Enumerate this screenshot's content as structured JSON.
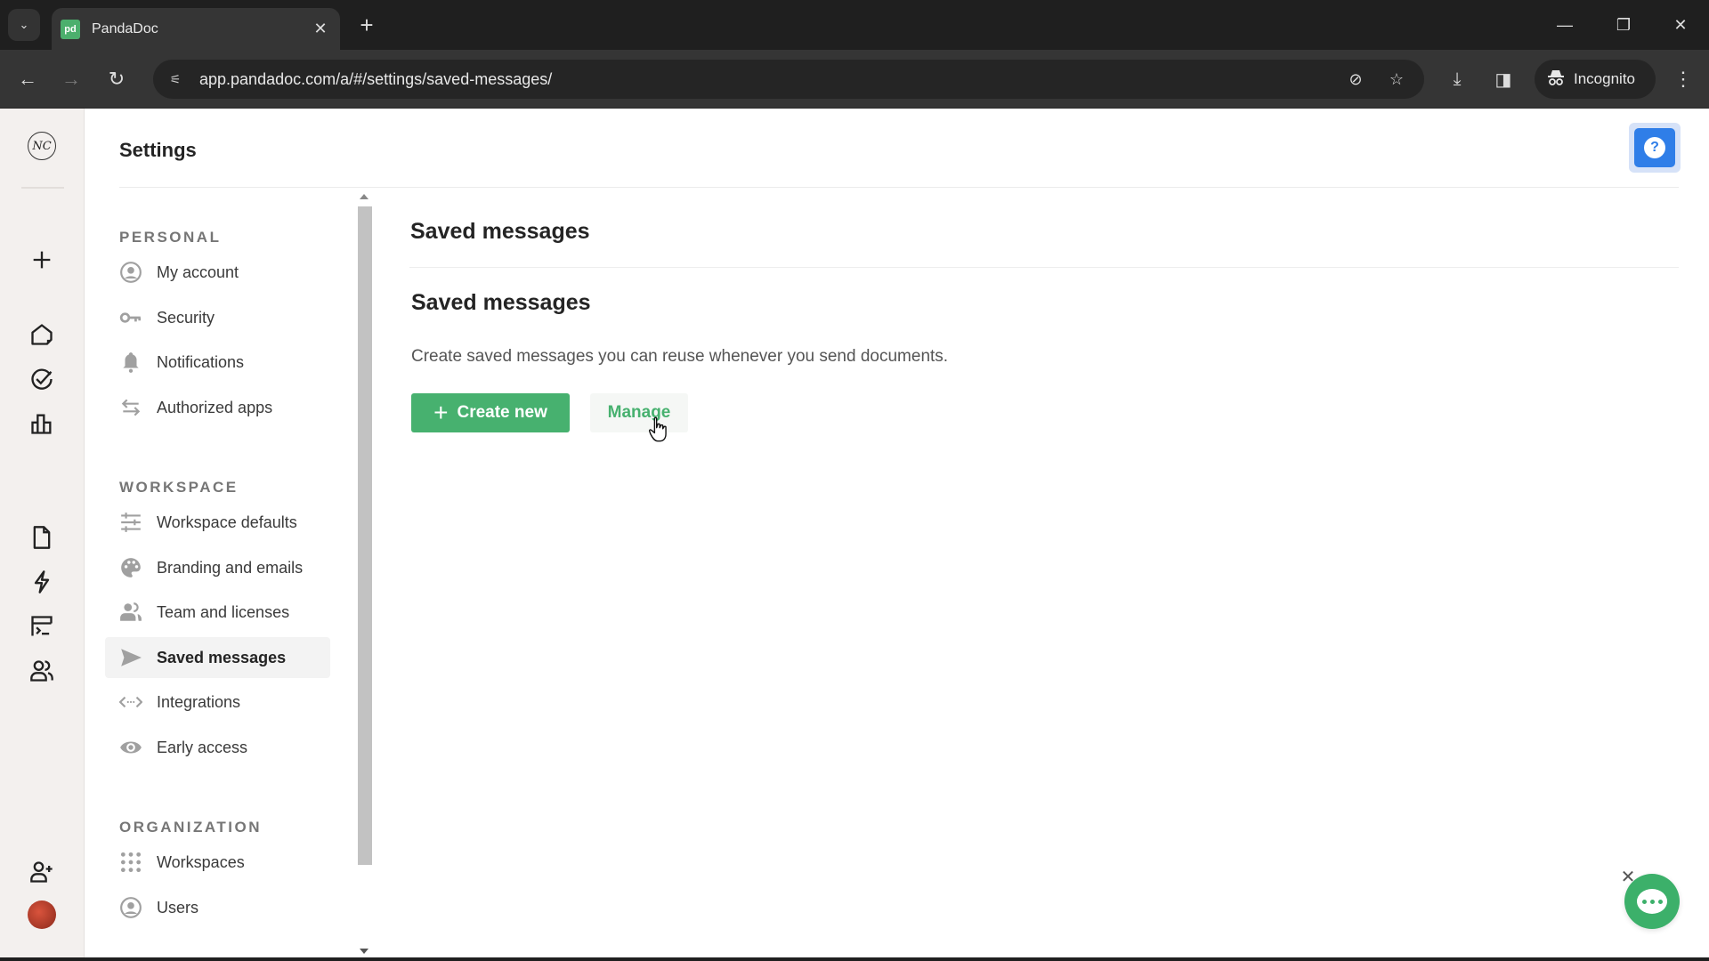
{
  "browser": {
    "tab_title": "PandaDoc",
    "tab_favicon": "pd",
    "url": "app.pandadoc.com/a/#/settings/saved-messages/",
    "incognito_label": "Incognito",
    "icons": {
      "tab_search": "chevron-down-icon",
      "tab_close": "close-icon",
      "new_tab": "plus-icon",
      "back": "arrow-left-icon",
      "forward": "arrow-right-icon",
      "reload": "reload-icon",
      "site_info": "tune-icon",
      "eye_off": "eye-off-icon",
      "bookmark": "star-icon",
      "download": "download-icon",
      "side_panel": "side-panel-icon",
      "incognito": "incognito-icon",
      "menu": "more-vertical-icon"
    },
    "glyphs": {
      "chevron": "⌄",
      "close": "✕",
      "plus": "+",
      "back": "←",
      "forward": "→",
      "reload": "↻",
      "tune": "⚟",
      "eye_off": "⊘",
      "star": "☆",
      "download": "⤓",
      "side_panel": "◨",
      "incognito": "🕶",
      "menu": "⋮",
      "minimize": "—",
      "restore": "❐",
      "win_close": "✕"
    }
  },
  "rail": {
    "logo_text": "NC",
    "items": [
      {
        "name": "create",
        "icon": "plus-icon"
      },
      {
        "name": "home",
        "icon": "home-icon"
      },
      {
        "name": "tasks",
        "icon": "check-circle-icon"
      },
      {
        "name": "reports",
        "icon": "bar-chart-icon"
      },
      {
        "name": "documents",
        "icon": "document-icon"
      },
      {
        "name": "automations",
        "icon": "lightning-icon"
      },
      {
        "name": "forms",
        "icon": "form-icon"
      },
      {
        "name": "contacts",
        "icon": "contacts-icon"
      },
      {
        "name": "invite",
        "icon": "add-user-icon"
      }
    ]
  },
  "settings": {
    "title": "Settings",
    "help_glyph": "?",
    "sections": [
      {
        "label": "PERSONAL",
        "items": [
          {
            "label": "My account",
            "icon": "user-circle-icon"
          },
          {
            "label": "Security",
            "icon": "key-icon"
          },
          {
            "label": "Notifications",
            "icon": "bell-icon"
          },
          {
            "label": "Authorized apps",
            "icon": "swap-arrows-icon"
          }
        ]
      },
      {
        "label": "WORKSPACE",
        "items": [
          {
            "label": "Workspace defaults",
            "icon": "sliders-icon"
          },
          {
            "label": "Branding and emails",
            "icon": "palette-icon"
          },
          {
            "label": "Team and licenses",
            "icon": "team-icon"
          },
          {
            "label": "Saved messages",
            "icon": "send-icon",
            "active": true
          },
          {
            "label": "Integrations",
            "icon": "code-icon"
          },
          {
            "label": "Early access",
            "icon": "eye-icon"
          }
        ]
      },
      {
        "label": "ORGANIZATION",
        "items": [
          {
            "label": "Workspaces",
            "icon": "grid-icon"
          },
          {
            "label": "Users",
            "icon": "user-circle-icon"
          }
        ]
      }
    ]
  },
  "main": {
    "page_heading": "Saved messages",
    "section_heading": "Saved messages",
    "description": "Create saved messages you can reuse whenever you send documents.",
    "create_button": "Create new",
    "create_plus": "+",
    "manage_button": "Manage"
  },
  "chat": {
    "close_glyph": "✕"
  },
  "colors": {
    "brand_green": "#47b16f",
    "help_blue": "#2f7ee8",
    "chrome_dark": "#1f1f1f"
  }
}
